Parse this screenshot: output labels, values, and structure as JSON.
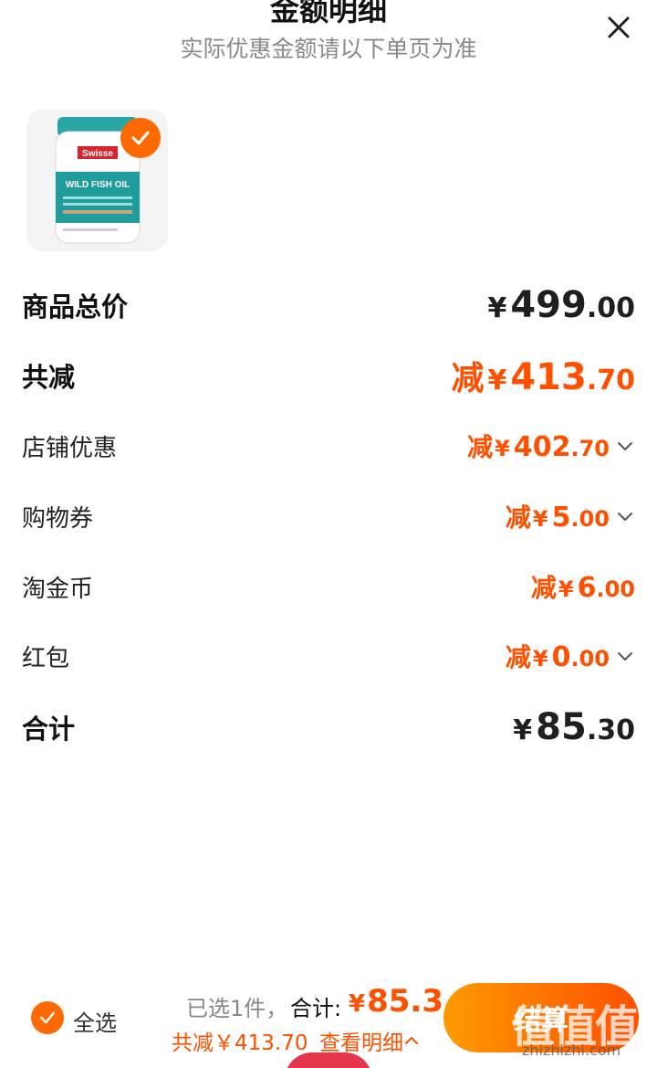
{
  "header": {
    "title": "金额明细",
    "subtitle": "实际优惠金额请以下单页为准"
  },
  "icons": {
    "close": "close-icon",
    "check": "checkmark-icon",
    "chevron": "chevron-down-icon",
    "chevron_up": "chevron-up-icon"
  },
  "product": {
    "brand_label": "Swisse",
    "product_label": "WILD FISH OIL",
    "selected": true
  },
  "rows": {
    "total_price": {
      "label": "商品总价",
      "currency": "¥",
      "integer": "499",
      "decimal": ".00"
    },
    "total_discount": {
      "label": "共减",
      "prefix": "减",
      "currency": "¥",
      "integer": "413",
      "decimal": ".70"
    },
    "shop_discount": {
      "label": "店铺优惠",
      "prefix": "减",
      "currency": "¥",
      "integer": "402",
      "decimal": ".70"
    },
    "coupon": {
      "label": "购物券",
      "prefix": "减",
      "currency": "¥",
      "integer": "5",
      "decimal": ".00"
    },
    "taojin_coin": {
      "label": "淘金币",
      "prefix": "减",
      "currency": "¥",
      "integer": "6",
      "decimal": ".00"
    },
    "red_packet": {
      "label": "红包",
      "prefix": "减",
      "currency": "¥",
      "integer": "0",
      "decimal": ".00"
    },
    "subtotal": {
      "label": "合计",
      "currency": "¥",
      "integer": "85",
      "decimal": ".30"
    }
  },
  "footer": {
    "select_all": "全选",
    "selected_count": "已选1件，",
    "total_label": "合计:",
    "total_currency": "¥",
    "total_value": "85.3",
    "saved_text": "共减￥413.70",
    "detail_link": "查看明细",
    "checkout": "结算",
    "watermark": "值值值",
    "watermark_url": "zhizhizhi.com"
  },
  "colors": {
    "accent": "#ff5000",
    "accent_light": "#ff9a00",
    "teal": "#1f9c9c"
  }
}
